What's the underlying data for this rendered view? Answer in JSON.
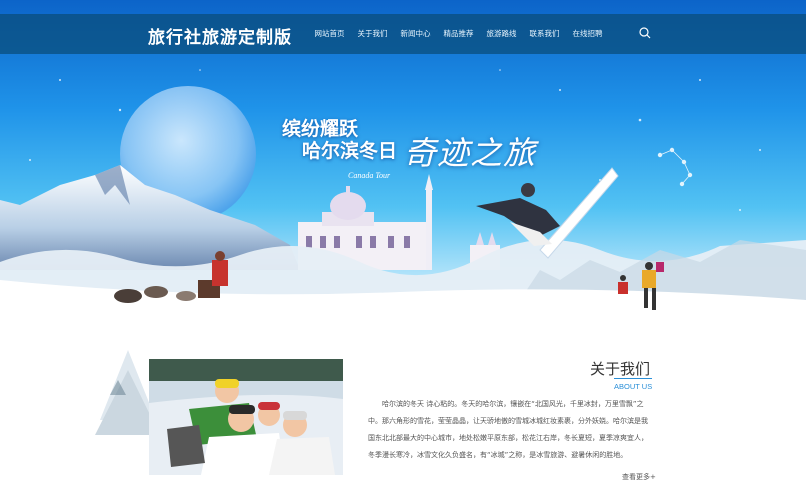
{
  "header": {
    "logo": "旅行社旅游定制版",
    "menu": [
      {
        "label": "网站首页"
      },
      {
        "label": "关于我们"
      },
      {
        "label": "新闻中心"
      },
      {
        "label": "精品推荐"
      },
      {
        "label": "旅游路线"
      },
      {
        "label": "联系我们"
      },
      {
        "label": "在线招聘"
      }
    ],
    "search_icon": "search-icon"
  },
  "banner": {
    "line1": "缤纷耀跃",
    "line2": "哈尔滨冬日",
    "script_title": "奇迹之旅",
    "small_text": "Canada Tour"
  },
  "about": {
    "title": "关于我们",
    "subtitle": "ABOUT US",
    "text": "哈尔滨的冬天 诗心粘的。冬天的哈尔滨，镶嵌在“北国风光，千里冰封，万里雪飘”之中。那六角形的雪花，莹莹晶晶，让天骄地傲的雪城冰城红妆素裹，分外妖娆。哈尔滨是我国东北北部最大的中心城市，地处松嫩平原东部，松花江右岸，冬长夏短，夏季凉爽宜人，冬季漫长寒冷，冰雪文化久负盛名，有“冰城”之称，是冰雪旅游、避暑休闲的胜地。",
    "more": "查看更多+"
  },
  "colors": {
    "nav_bg": "#0a4c78",
    "accent": "#2a8fd8",
    "sky_top": "#0c64c9"
  }
}
